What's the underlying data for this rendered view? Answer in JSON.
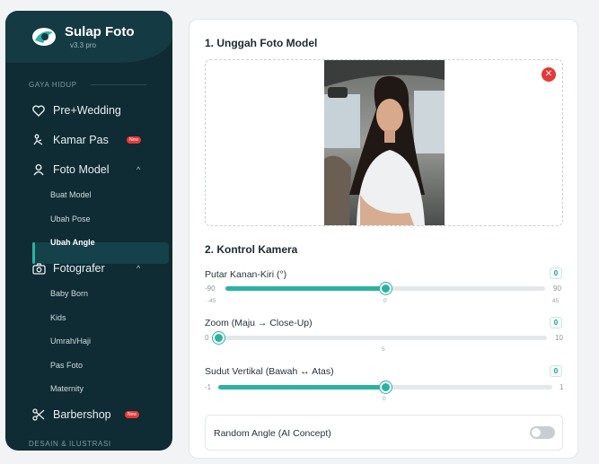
{
  "brand": {
    "name": "Sulap Foto",
    "version": "v3.3 pro"
  },
  "sidebar": {
    "section1": "GAYA HIDUP",
    "section2": "DESAIN & ILUSTRASI",
    "items": [
      {
        "label": "Pre+Wedding",
        "icon": "heart-icon"
      },
      {
        "label": "Kamar Pas",
        "icon": "hanger-icon",
        "badge": "New"
      },
      {
        "label": "Foto Model",
        "icon": "person-icon"
      },
      {
        "label": "Fotografer",
        "icon": "camera-icon"
      },
      {
        "label": "Barbershop",
        "icon": "scissors-icon",
        "badge": "New"
      }
    ],
    "foto_model_sub": [
      "Buat Model",
      "Ubah Pose",
      "Ubah Angle"
    ],
    "fotografer_sub": [
      "Baby Born",
      "Kids",
      "Umrah/Haji",
      "Pas Foto",
      "Maternity"
    ],
    "active_sub": "Ubah Angle"
  },
  "main": {
    "upload_title": "1. Unggah Foto Model",
    "camera_title": "2. Kontrol Kamera",
    "sliders": [
      {
        "label": "Putar Kanan-Kiri (°)",
        "value": "0",
        "min": "-90",
        "max": "90",
        "ticks": [
          "-45",
          "0",
          "45"
        ],
        "fraction": 0.5
      },
      {
        "label": "Zoom (Maju → Close-Up)",
        "value": "0",
        "min": "0",
        "max": "10",
        "ticks": [
          "5"
        ],
        "fraction": 0.0
      },
      {
        "label": "Sudut Vertikal (Bawah ↔ Atas)",
        "value": "0",
        "min": "-1",
        "max": "1",
        "ticks": [
          "0"
        ],
        "fraction": 0.5
      }
    ],
    "random_label": "Random Angle (AI Concept)",
    "random_enabled": false
  },
  "colors": {
    "accent": "#2bb3a0",
    "sidebar_bg": "#0f2b33",
    "danger": "#e53935"
  }
}
